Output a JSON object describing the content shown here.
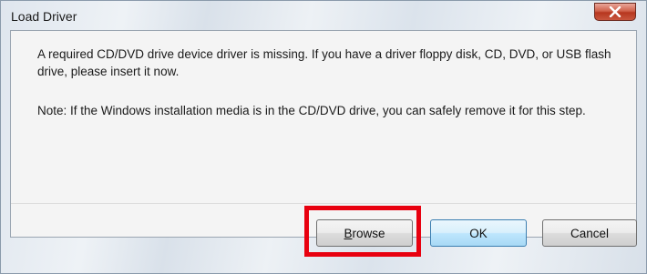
{
  "window": {
    "title": "Load Driver"
  },
  "message": {
    "line_main": "A required CD/DVD drive device driver is missing. If you have a driver floppy disk, CD, DVD, or USB flash drive, please insert it now.",
    "line_note": "Note: If the Windows installation media is in the CD/DVD drive, you can safely remove it for this step."
  },
  "buttons": {
    "browse_first": "B",
    "browse_rest": "rowse",
    "ok": "OK",
    "cancel": "Cancel"
  },
  "icons": {
    "close": "close-icon"
  },
  "colors": {
    "highlight": "#e8000f",
    "close_button": "#c8563e",
    "default_button_border": "#3c7fb1"
  }
}
